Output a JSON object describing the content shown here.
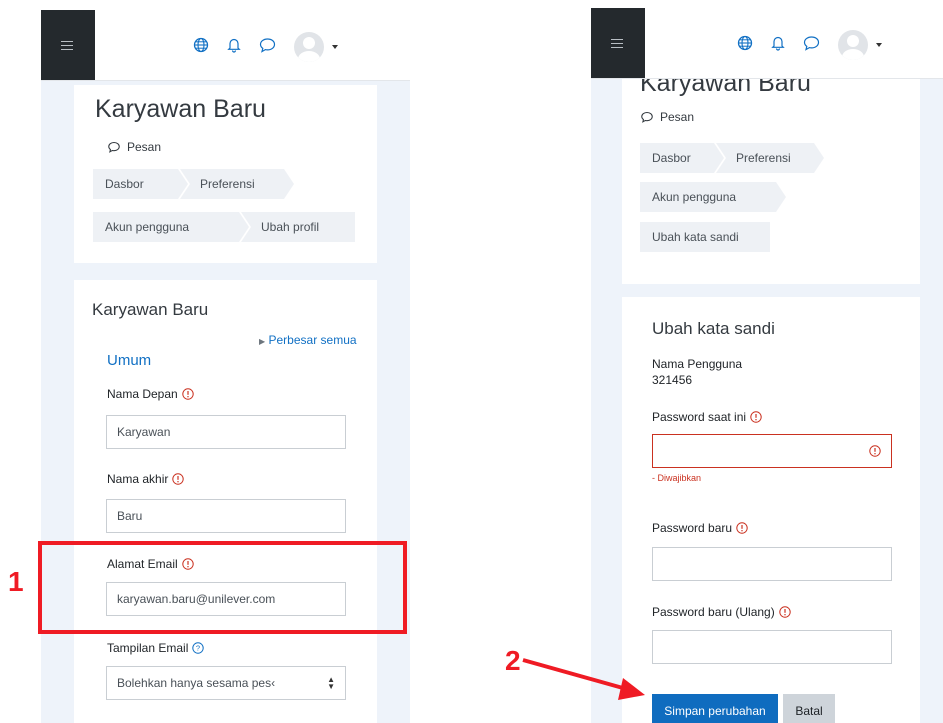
{
  "left": {
    "heading": "Karyawan Baru",
    "pesan": "Pesan",
    "breadcrumbs": [
      "Dasbor",
      "Preferensi",
      "Akun pengguna",
      "Ubah profil"
    ],
    "form_title": "Karyawan Baru",
    "expand_all": "Perbesar semua",
    "section": "Umum",
    "first_name_label": "Nama Depan",
    "first_name_value": "Karyawan",
    "last_name_label": "Nama akhir",
    "last_name_value": "Baru",
    "email_label": "Alamat Email",
    "email_value": "karyawan.baru@unilever.com",
    "email_display_label": "Tampilan Email",
    "email_display_value": "Bolehkan hanya sesama pes‹"
  },
  "right": {
    "heading": "Karyawan Baru",
    "pesan": "Pesan",
    "breadcrumbs": [
      "Dasbor",
      "Preferensi",
      "Akun pengguna",
      "Ubah kata sandi"
    ],
    "form_title": "Ubah kata sandi",
    "username_label": "Nama Pengguna",
    "username_value": "321456",
    "current_password_label": "Password saat ini",
    "required_error": "- Diwajibkan",
    "new_password_label": "Password baru",
    "new_password_repeat_label": "Password baru (Ulang)",
    "save_button": "Simpan perubahan",
    "cancel_button": "Batal"
  },
  "annotations": {
    "step1": "1",
    "step2": "2"
  },
  "colors": {
    "navbar_dark": "#24292d",
    "link": "#1170c4",
    "primary": "#0f6cbf",
    "error": "#ca3120",
    "annotation": "#ef1b24"
  },
  "icons": [
    "menu-icon",
    "globe-icon",
    "bell-icon",
    "chat-icon",
    "user-avatar",
    "dropdown-caret-icon",
    "required-icon",
    "help-icon"
  ]
}
